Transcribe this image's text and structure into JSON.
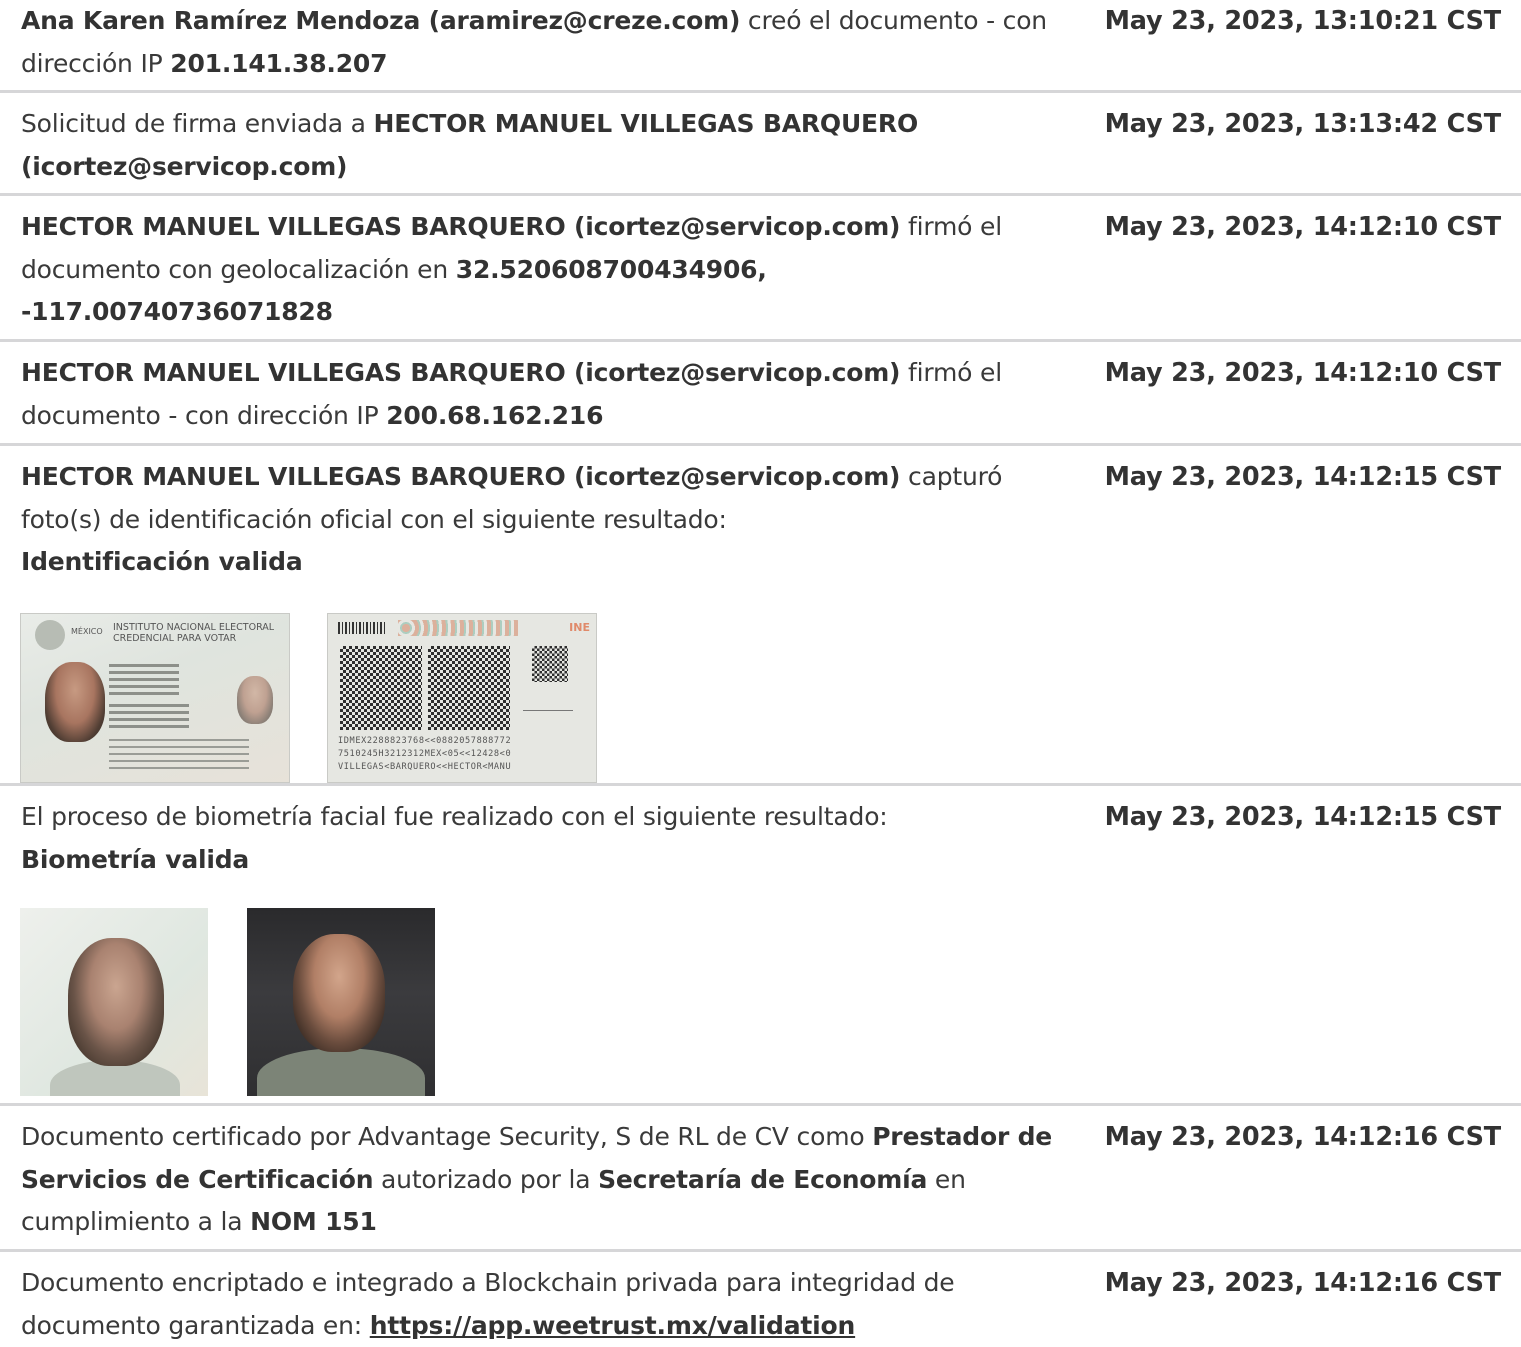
{
  "entries": [
    {
      "parts": [
        {
          "text": "Ana Karen Ramírez Mendoza (aramirez@creze.com)",
          "bold": true
        },
        {
          "text": " creó el documento - con dirección IP ",
          "bold": false
        },
        {
          "text": "201.141.38.207",
          "bold": true
        }
      ],
      "timestamp": "May 23, 2023, 13:10:21 CST"
    },
    {
      "parts": [
        {
          "text": "Solicitud de firma enviada a ",
          "bold": false
        },
        {
          "text": "HECTOR MANUEL VILLEGAS BARQUERO (icortez@servicop.com)",
          "bold": true
        }
      ],
      "timestamp": "May 23, 2023, 13:13:42 CST"
    },
    {
      "parts": [
        {
          "text": "HECTOR MANUEL VILLEGAS BARQUERO (icortez@servicop.com)",
          "bold": true
        },
        {
          "text": " firmó el documento con geolocalización en ",
          "bold": false
        },
        {
          "text": "32.520608700434906, -117.00740736071828",
          "bold": true
        }
      ],
      "timestamp": "May 23, 2023, 14:12:10 CST"
    },
    {
      "parts": [
        {
          "text": "HECTOR MANUEL VILLEGAS BARQUERO (icortez@servicop.com)",
          "bold": true
        },
        {
          "text": " firmó el documento - con dirección IP ",
          "bold": false
        },
        {
          "text": "200.68.162.216",
          "bold": true
        }
      ],
      "timestamp": "May 23, 2023, 14:12:10 CST"
    },
    {
      "parts": [
        {
          "text": "HECTOR MANUEL VILLEGAS BARQUERO (icortez@servicop.com)",
          "bold": true
        },
        {
          "text": " capturó foto(s) de identificación oficial con el siguiente resultado:",
          "bold": false
        },
        {
          "text": "Identificación valida",
          "bold": true,
          "newline": true
        }
      ],
      "timestamp": "May 23, 2023, 14:12:15 CST",
      "id_card": {
        "front": {
          "country": "MÉXICO",
          "institute": "INSTITUTO NACIONAL ELECTORAL",
          "credential": "CREDENCIAL PARA VOTAR"
        },
        "back": {
          "brand": "INE",
          "mrz": [
            "IDMEX2288823768<<0882057888772",
            "7510245H3212312MEX<05<<12428<0",
            "VILLEGAS<BARQUERO<<HECTOR<MANU"
          ]
        }
      }
    },
    {
      "parts": [
        {
          "text": "El proceso de biometría facial fue realizado con el siguiente resultado:",
          "bold": false
        },
        {
          "text": "Biometría valida",
          "bold": true,
          "newline": true
        }
      ],
      "timestamp": "May 23, 2023, 14:12:15 CST",
      "photos": [
        "id-photo",
        "selfie-photo"
      ]
    },
    {
      "parts": [
        {
          "text": "Documento certificado por Advantage Security, S de RL de CV como ",
          "bold": false
        },
        {
          "text": "Prestador de Servicios de Certificación",
          "bold": true
        },
        {
          "text": " autorizado por la ",
          "bold": false
        },
        {
          "text": "Secretaría de Economía",
          "bold": true
        },
        {
          "text": " en cumplimiento a la ",
          "bold": false
        },
        {
          "text": "NOM 151",
          "bold": true
        }
      ],
      "timestamp": "May 23, 2023, 14:12:16 CST"
    },
    {
      "parts": [
        {
          "text": "Documento encriptado e integrado a Blockchain privada para integridad de documento garantizada en: ",
          "bold": false
        },
        {
          "text": "https://app.weetrust.mx/validation",
          "bold": true,
          "link": true
        }
      ],
      "timestamp": "May 23, 2023, 14:12:16 CST"
    }
  ]
}
